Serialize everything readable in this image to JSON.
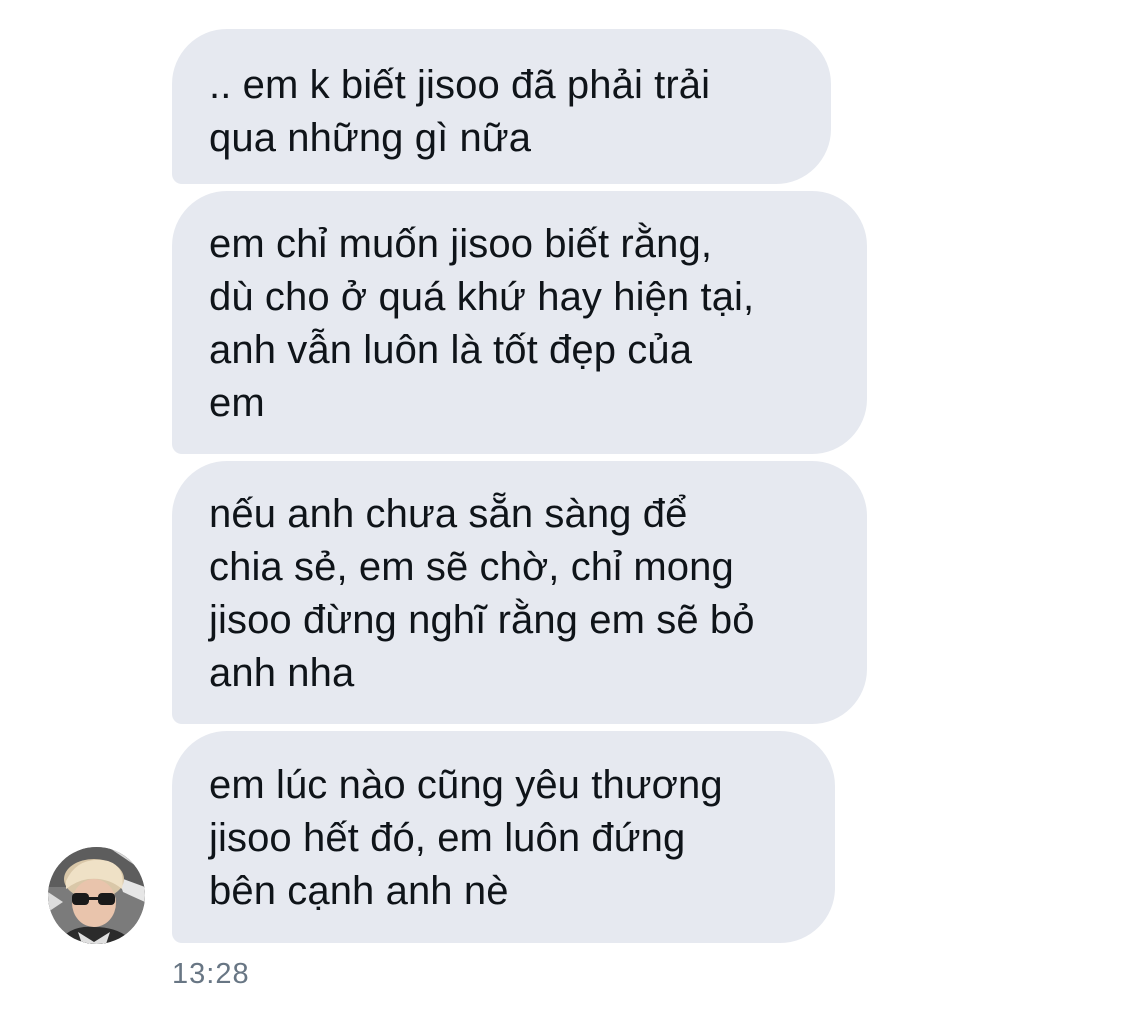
{
  "messages": [
    {
      "text": ".. em k biết jisoo đã phải trải\nqua những gì nữa"
    },
    {
      "text": "em chỉ muốn jisoo biết rằng,\ndù cho ở quá khứ hay hiện tại,\nanh vẫn luôn là tốt đẹp của\nem"
    },
    {
      "text": "nếu anh chưa sẵn sàng để\nchia sẻ, em sẽ chờ, chỉ mong\njisoo đừng nghĩ rằng em sẽ bỏ\nanh nha"
    },
    {
      "text": "em lúc nào cũng yêu thương\njisoo hết đó, em luôn đứng\nbên cạnh anh nè"
    }
  ],
  "timestamp": "13:28",
  "colors": {
    "bubble_background": "#e6e9f0",
    "message_text": "#0f1419",
    "timestamp_text": "#687684",
    "page_background": "#ffffff"
  },
  "avatar": {
    "icon": "user-avatar-photo"
  }
}
